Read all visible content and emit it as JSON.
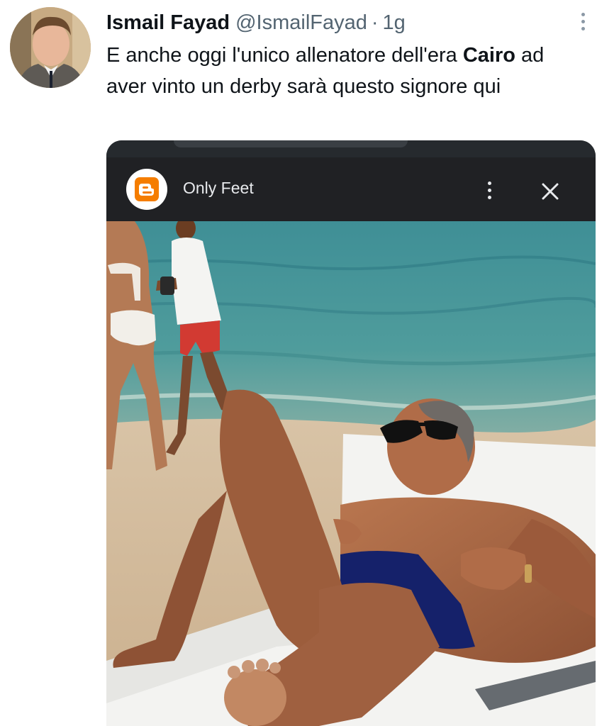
{
  "tweet": {
    "author_name": "Ismail Fayad",
    "handle": "@IsmailFayad",
    "separator": "·",
    "time": "1g",
    "text_before": "E anche oggi l'unico allenatore dell'era ",
    "text_bold": "Cairo",
    "text_after": " ad aver vinto un derby sarà questo signore qui"
  },
  "embedded_screenshot": {
    "app_title": "Only Feet",
    "app_icon": "blogger-icon",
    "menu_icon": "more-vertical-icon",
    "close_icon": "close-icon"
  },
  "colors": {
    "text": "#0f1419",
    "secondary_text": "#536471",
    "app_bar": "#202124",
    "blogger_orange": "#f57d00"
  }
}
